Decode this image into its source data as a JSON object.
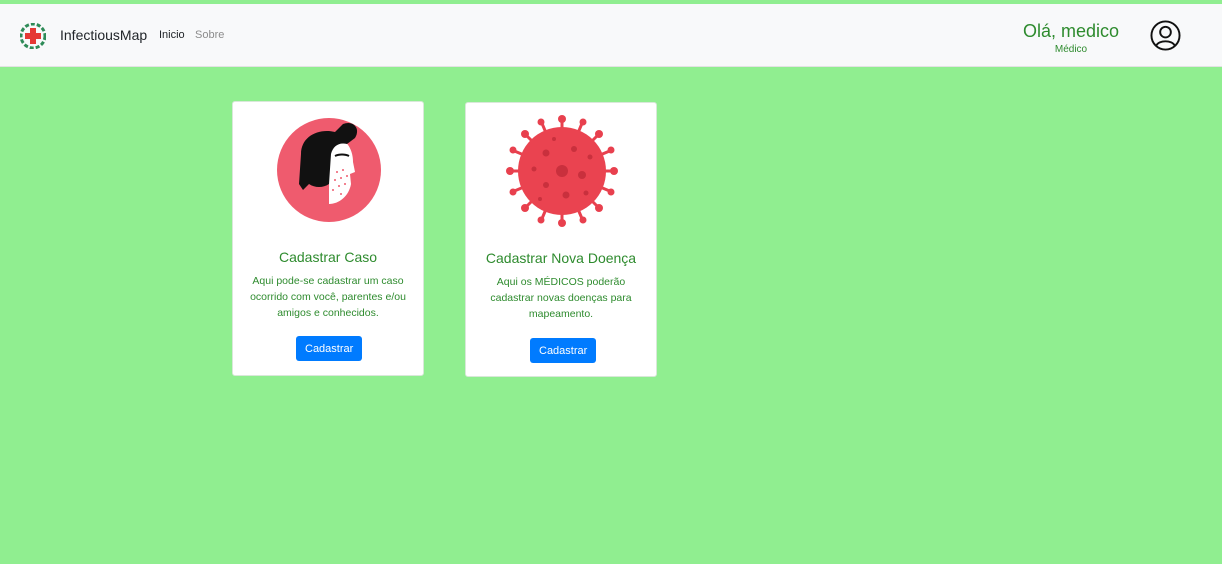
{
  "brand": {
    "name": "InfectiousMap"
  },
  "nav": {
    "home": "Inicio",
    "about": "Sobre"
  },
  "user": {
    "greeting": "Olá, medico",
    "role": "Médico"
  },
  "cards": [
    {
      "title": "Cadastrar Caso",
      "text": "Aqui pode-se cadastrar um caso ocorrido com você, parentes e/ou amigos e conhecidos.",
      "button": "Cadastrar"
    },
    {
      "title": "Cadastrar Nova Doença",
      "text": "Aqui os MÉDICOS poderão cadastrar novas doenças para mapeamento.",
      "button": "Cadastrar"
    }
  ],
  "colors": {
    "background": "#90ee90",
    "accent_text": "#2e8b2e",
    "button": "#007bff",
    "illustration": "#ef4d5c"
  }
}
